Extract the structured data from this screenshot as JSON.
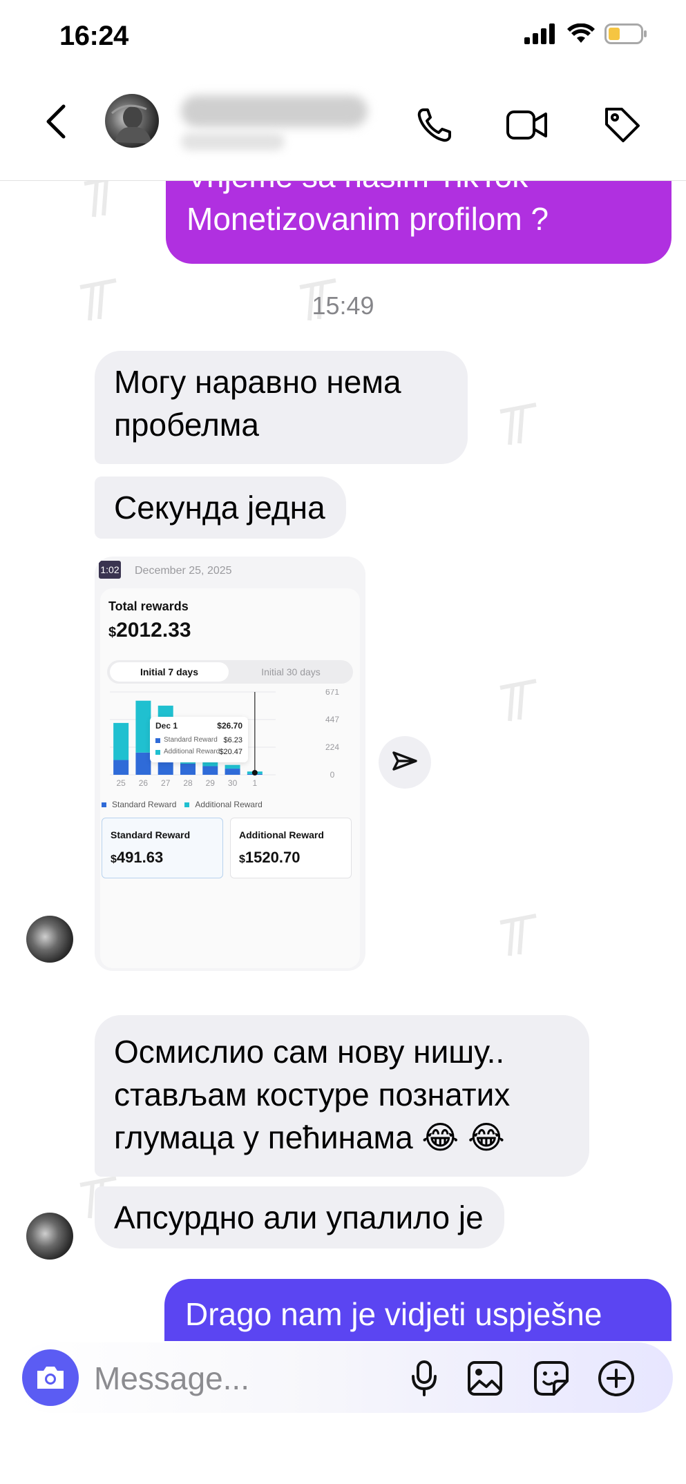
{
  "status_bar": {
    "time": "16:24",
    "icons": [
      "cellular-signal-icon",
      "wifi-icon",
      "battery-icon"
    ],
    "battery_color": "#f5c542"
  },
  "header": {
    "contact_name": "████ ████████",
    "contact_subtitle": "██████████",
    "icons": [
      "back-chevron-icon",
      "phone-icon",
      "video-camera-icon",
      "tag-icon"
    ]
  },
  "messages": [
    {
      "type": "outgoing",
      "text": "Vrijeme sa našim TikTok Monetizovanim profilom ?",
      "color": "#b030e0"
    },
    {
      "type": "timestamp",
      "text": "15:49"
    },
    {
      "type": "incoming",
      "text": "Могу наравно нема пробелма"
    },
    {
      "type": "incoming",
      "text": "Секунда једна"
    },
    {
      "type": "incoming-image",
      "caption": "screenshot"
    },
    {
      "type": "incoming",
      "text": "Осмислио сам нову нишу.. стављам костуре познатих глумаца у пећинама 😂 😂"
    },
    {
      "type": "incoming",
      "text": "Апсурдно али упалило је"
    },
    {
      "type": "outgoing",
      "text": "Drago nam je vidjeti uspješne",
      "color": "#5b45f2"
    }
  ],
  "reaction": {
    "emoji": "❤️"
  },
  "screenshot": {
    "duration_badge": "1:02",
    "date": "December 25, 2025",
    "total_label": "Total rewards",
    "total_currency": "$",
    "total_value": "2012.33",
    "tabs": [
      "Initial 7 days",
      "Initial 30 days"
    ],
    "active_tab": 0,
    "tooltip": {
      "title": "Dec 1",
      "total": "$26.70",
      "rows": [
        {
          "label": "Standard Reward",
          "value": "$6.23",
          "color": "#2f6bd8"
        },
        {
          "label": "Additional Reward",
          "value": "$20.47",
          "color": "#20c0d0"
        }
      ]
    },
    "legend": [
      "Standard Reward",
      "Additional Reward"
    ],
    "cards": [
      {
        "label": "Standard Reward",
        "currency": "$",
        "value": "491.63"
      },
      {
        "label": "Additional Reward",
        "currency": "$",
        "value": "1520.70"
      }
    ],
    "chart_data": {
      "type": "bar",
      "categories": [
        "25",
        "26",
        "27",
        "28",
        "29",
        "30",
        "1"
      ],
      "series": [
        {
          "name": "Standard Reward",
          "values": [
            120,
            180,
            130,
            90,
            70,
            50,
            6.23
          ],
          "color": "#2f6bd8"
        },
        {
          "name": "Additional Reward",
          "values": [
            300,
            420,
            430,
            40,
            40,
            30,
            20.47
          ],
          "color": "#20c0d0"
        }
      ],
      "yticks": [
        "671",
        "447",
        "224",
        "0"
      ],
      "ylim": [
        0,
        671
      ]
    }
  },
  "composer": {
    "placeholder": "Message...",
    "icons": [
      "camera-icon",
      "microphone-icon",
      "image-icon",
      "sticker-icon",
      "add-circle-icon"
    ]
  }
}
